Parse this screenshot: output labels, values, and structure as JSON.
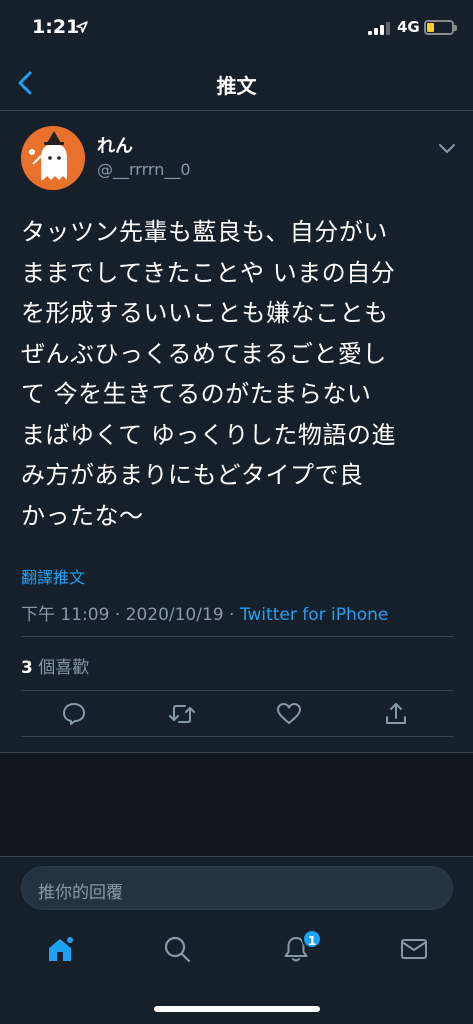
{
  "status_bar": {
    "time": "1:21",
    "network": "4G"
  },
  "header": {
    "title": "推文"
  },
  "tweet": {
    "display_name": "れん",
    "handle": "@__rrrrn__0",
    "text_lines": [
      "タッツン先輩も藍良も、自分がい",
      "ままでしてきたことや いまの自分",
      "を形成するいいことも嫌なことも",
      "ぜんぶひっくるめてまるごと愛し",
      "て 今を生きてるのがたまらない",
      "まばゆくて ゆっくりした物語の進",
      "み方があまりにもどタイプで良",
      "かったな〜"
    ],
    "translate_label": "翻譯推文",
    "time": "下午 11:09",
    "date": "2020/10/19",
    "source": "Twitter for iPhone",
    "meta_separator": "·",
    "likes_count": "3",
    "likes_label": "個喜歡"
  },
  "reply": {
    "placeholder": "推你的回覆"
  },
  "tab_bar": {
    "notification_badge": "1"
  },
  "colors": {
    "background": "#15202b",
    "accent": "#1da1f2",
    "secondary_text": "#8899a6",
    "divider": "#38444d",
    "avatar_bg": "#e8712c"
  }
}
